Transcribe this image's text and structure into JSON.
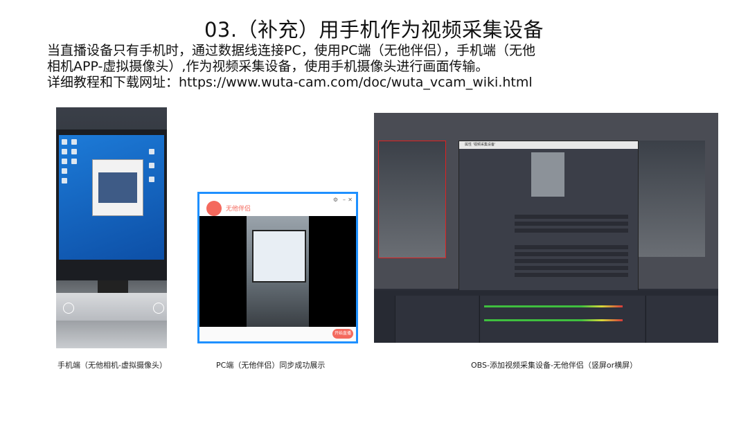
{
  "title": "03.（补充）用手机作为视频采集设备",
  "description": {
    "line1": "当直播设备只有手机时，通过数据线连接PC，使用PC端（无他伴侣），手机端（无他",
    "line2": "相机APP-虚拟摄像头）,作为视频采集设备，使用手机摄像头进行画面传输。",
    "line3": "详细教程和下载网址：https://www.wuta-cam.com/doc/wuta_vcam_wiki.html"
  },
  "captions": {
    "phone": "手机端（无他相机-虚拟摄像头）",
    "pc": "PC端（无他伴侣）同步成功展示",
    "obs": "OBS-添加视频采集设备-无他伴侣（竖屏or横屏）"
  },
  "pc_client": {
    "app_name": "无他伴侣",
    "start_button": "开始直播"
  },
  "obs": {
    "dialog_title": "属性 '视频采集设备'"
  },
  "colors": {
    "accent_red": "#f4695d",
    "border_blue": "#1e90ff",
    "obs_bg": "#2b2e38"
  }
}
